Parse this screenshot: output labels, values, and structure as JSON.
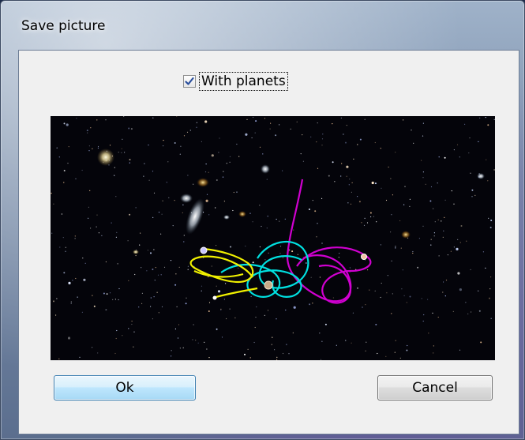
{
  "window": {
    "title": "Save picture"
  },
  "options": {
    "with_planets_label": "With planets",
    "with_planets_checked": true
  },
  "preview": {
    "description_icon": "space-picture",
    "orbit_colors": {
      "yellow": "#f0f000",
      "cyan": "#00e0e0",
      "magenta": "#d000d0"
    }
  },
  "buttons": {
    "ok_label": "Ok",
    "cancel_label": "Cancel"
  },
  "colors": {
    "ok_border": "#3c7fb1",
    "client_bg": "#f0f0f0"
  }
}
